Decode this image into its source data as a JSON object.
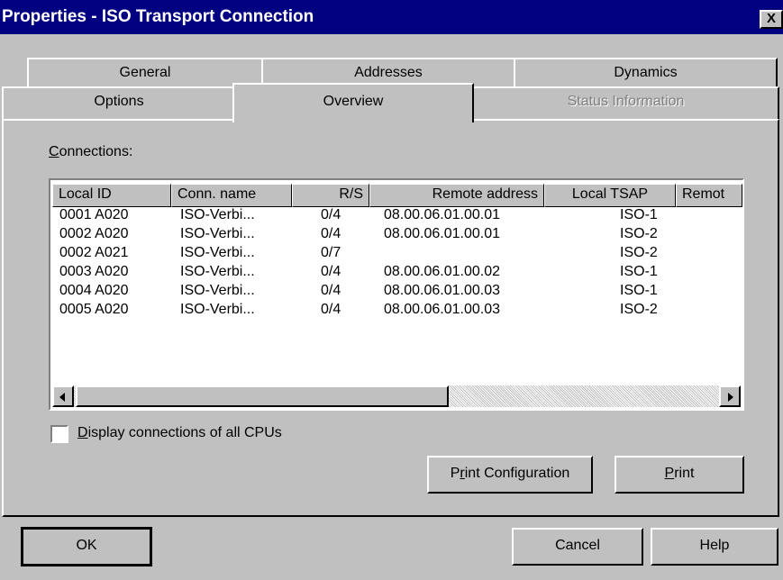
{
  "window": {
    "title": "Properties - ISO Transport Connection",
    "close_label": "X"
  },
  "tabs": {
    "row1": [
      {
        "label": "General"
      },
      {
        "label": "Addresses"
      },
      {
        "label": "Dynamics"
      }
    ],
    "row2": [
      {
        "label": "Options"
      },
      {
        "label": "Overview",
        "active": true
      },
      {
        "label": "Status Information",
        "disabled": true
      }
    ]
  },
  "connections": {
    "label_hotkey": "C",
    "label_rest": "onnections:",
    "columns": [
      {
        "label": "Local ID"
      },
      {
        "label": "Conn. name"
      },
      {
        "label": "R/S"
      },
      {
        "label": "Remote address"
      },
      {
        "label": "Local TSAP"
      },
      {
        "label": "Remot"
      }
    ],
    "rows": [
      {
        "local_id": "0001 A020",
        "conn_name": "ISO-Verbi...",
        "rs": "0/4",
        "remote_address": "08.00.06.01.00.01",
        "local_tsap": "ISO-1"
      },
      {
        "local_id": "0002 A020",
        "conn_name": "ISO-Verbi...",
        "rs": "0/4",
        "remote_address": "08.00.06.01.00.01",
        "local_tsap": "ISO-2"
      },
      {
        "local_id": "0002 A021",
        "conn_name": "ISO-Verbi...",
        "rs": "0/7",
        "remote_address": "",
        "local_tsap": "ISO-2"
      },
      {
        "local_id": "0003 A020",
        "conn_name": "ISO-Verbi...",
        "rs": "0/4",
        "remote_address": "08.00.06.01.00.02",
        "local_tsap": "ISO-1"
      },
      {
        "local_id": "0004 A020",
        "conn_name": "ISO-Verbi...",
        "rs": "0/4",
        "remote_address": "08.00.06.01.00.03",
        "local_tsap": "ISO-1"
      },
      {
        "local_id": "0005 A020",
        "conn_name": "ISO-Verbi...",
        "rs": "0/4",
        "remote_address": "08.00.06.01.00.03",
        "local_tsap": "ISO-2"
      }
    ]
  },
  "display_all": {
    "hotkey": "D",
    "rest": "isplay connections of all CPUs",
    "checked": false
  },
  "buttons": {
    "print_config": {
      "pre": "P",
      "hotkey": "r",
      "post": "int Configuration"
    },
    "print": {
      "hotkey": "P",
      "post": "rint"
    },
    "ok": "OK",
    "cancel": "Cancel",
    "help": "Help"
  }
}
